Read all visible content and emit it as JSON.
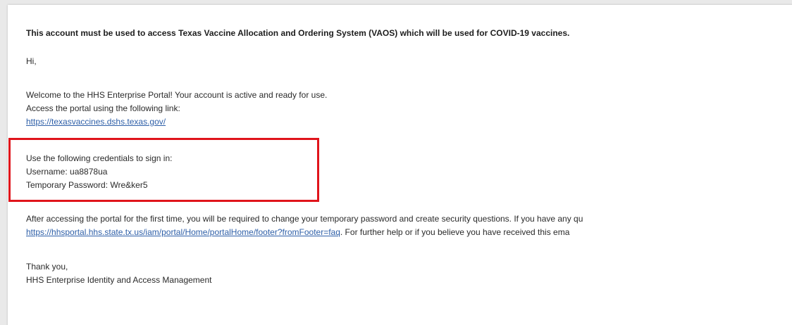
{
  "email": {
    "heading": "This account must be used to access Texas Vaccine Allocation and Ordering System (VAOS) which will be used for COVID-19 vaccines.",
    "greeting": "Hi,",
    "welcome_line": "Welcome to the HHS Enterprise Portal! Your account is active and ready for use.",
    "access_line": "Access the portal using the following link:",
    "portal_link": "https://texasvaccines.dshs.texas.gov/",
    "credentials_intro": "Use the following credentials to sign in:",
    "username_line": "Username: ua8878ua",
    "password_line": "Temporary Password: Wre&ker5",
    "after_line": "After accessing the portal for the first time, you will be required to change your temporary password and create security questions. If you have any qu",
    "faq_link": "https://hhsportal.hhs.state.tx.us/iam/portal/Home/portalHome/footer?fromFooter=faq",
    "after_line2_rest": ". For further help or if you believe you have received this ema",
    "thanks": "Thank you,",
    "signature": "HHS Enterprise Identity and Access Management"
  },
  "colors": {
    "highlight": "#e0141b",
    "link": "#2e5fa8",
    "background": "#e9e9e9"
  }
}
